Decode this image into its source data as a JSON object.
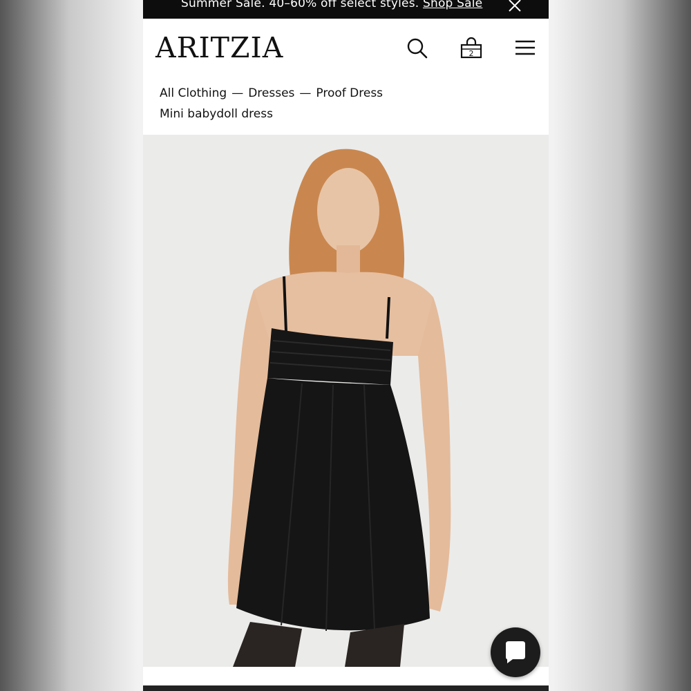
{
  "promo": {
    "text": "Summer Sale. 40–60% off select styles.",
    "link_label": "Shop Sale",
    "close_icon": "close-icon"
  },
  "header": {
    "logo": "ARITZIA",
    "search_icon": "search-icon",
    "bag_icon": "shopping-bag-icon",
    "bag_count": "2",
    "menu_icon": "hamburger-menu-icon"
  },
  "breadcrumb": {
    "items": [
      "All Clothing",
      "Dresses",
      "Proof Dress"
    ],
    "separator": "—"
  },
  "product": {
    "subtitle": "Mini babydoll dress",
    "image_icon": "product-photo"
  },
  "chat": {
    "icon": "chat-bubble-icon"
  },
  "colors": {
    "promo_bg": "#0d0d0d",
    "text": "#111111",
    "image_bg": "#ebebea",
    "dress": "#151515",
    "chat_bg": "#1c1c1c"
  }
}
